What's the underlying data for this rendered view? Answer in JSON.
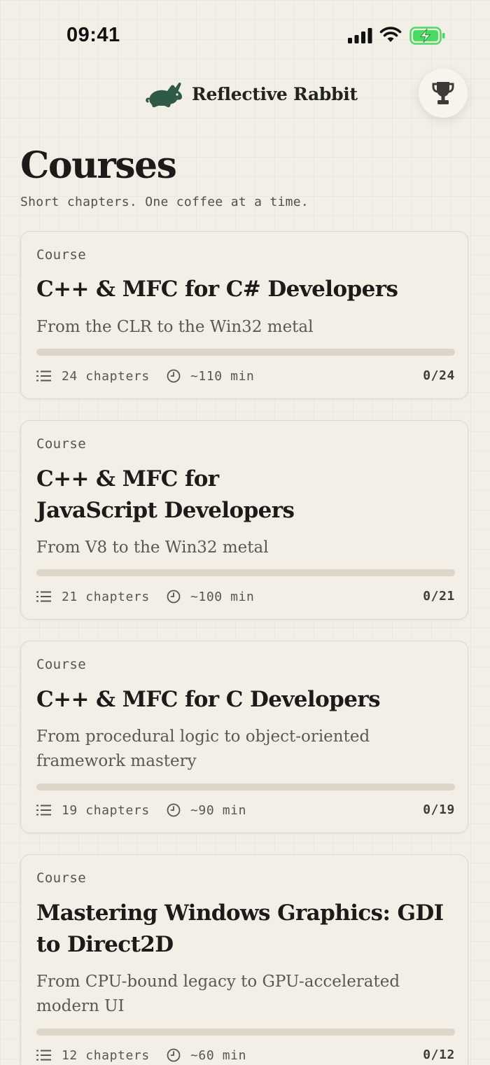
{
  "status_bar": {
    "time": "09:41"
  },
  "brand": {
    "name": "Reflective Rabbit",
    "logo_icon": "rabbit-icon",
    "logo_color": "#2f5a47"
  },
  "header": {
    "trophy_icon": "trophy-icon"
  },
  "page": {
    "title": "Courses",
    "subtitle": "Short chapters. One coffee at a time."
  },
  "courses": [
    {
      "kicker": "Course",
      "title": "C++ & MFC for C# Developers",
      "description": "From the CLR to the Win32 metal",
      "chapters": "24 chapters",
      "duration": "~110 min",
      "progress": "0/24",
      "progress_fraction": 0
    },
    {
      "kicker": "Course",
      "title": "C++ & MFC for JavaScript Developers",
      "description": "From V8 to the Win32 metal",
      "chapters": "21 chapters",
      "duration": "~100 min",
      "progress": "0/21",
      "progress_fraction": 0
    },
    {
      "kicker": "Course",
      "title": "C++ & MFC for C Developers",
      "description": "From procedural logic to object-oriented framework mastery",
      "chapters": "19 chapters",
      "duration": "~90 min",
      "progress": "0/19",
      "progress_fraction": 0
    },
    {
      "kicker": "Course",
      "title": "Mastering Windows Graphics: GDI to Direct2D",
      "description": "From CPU-bound legacy to GPU-accelerated modern UI",
      "chapters": "12 chapters",
      "duration": "~60 min",
      "progress": "0/12",
      "progress_fraction": 0
    }
  ],
  "colors": {
    "background": "#f2efe7",
    "card": "#f3efe6",
    "accent": "#2f5a47",
    "track": "#dcd6c8",
    "battery": "#4cd964"
  }
}
